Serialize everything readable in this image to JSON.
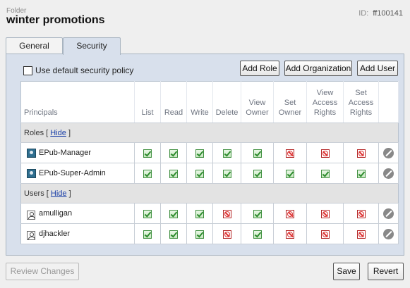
{
  "header": {
    "folder_label": "Folder",
    "title": "winter promotions",
    "id_label": "ID:",
    "id_value": "ff100141"
  },
  "tabs": [
    {
      "label": "General",
      "active": false
    },
    {
      "label": "Security",
      "active": true
    }
  ],
  "security": {
    "default_policy_label": "Use default security policy",
    "default_policy_checked": false,
    "add_role_label": "Add Role",
    "add_org_label": "Add Organization",
    "add_user_label": "Add User",
    "columns": {
      "principals": "Principals",
      "list": "List",
      "read": "Read",
      "write": "Write",
      "delete": "Delete",
      "view_owner": "View Owner",
      "set_owner": "Set Owner",
      "view_access_rights": "View Access Rights",
      "set_access_rights": "Set Access Rights"
    },
    "roles_group": {
      "label": "Roles",
      "hide_label": "Hide"
    },
    "users_group": {
      "label": "Users",
      "hide_label": "Hide"
    },
    "roles": [
      {
        "name": "EPub-Manager",
        "icon": "role-icon",
        "perms": [
          "allow",
          "allow",
          "allow",
          "allow",
          "allow",
          "deny",
          "deny",
          "deny"
        ]
      },
      {
        "name": "EPub-Super-Admin",
        "icon": "role-icon",
        "perms": [
          "allow",
          "allow",
          "allow",
          "allow",
          "allow",
          "allow",
          "allow",
          "allow"
        ]
      }
    ],
    "users": [
      {
        "name": "amulligan",
        "icon": "user-icon",
        "perms": [
          "allow",
          "allow",
          "allow",
          "deny",
          "allow",
          "deny",
          "deny",
          "deny"
        ]
      },
      {
        "name": "djhackler",
        "icon": "user-icon",
        "perms": [
          "allow",
          "allow",
          "allow",
          "deny",
          "allow",
          "deny",
          "deny",
          "deny"
        ]
      }
    ]
  },
  "footer": {
    "review_label": "Review Changes",
    "review_disabled": true,
    "save_label": "Save",
    "revert_label": "Revert"
  },
  "colors": {
    "panel_bg": "#d8e0ec",
    "allow": "#2e8b2e",
    "deny": "#d33333"
  }
}
